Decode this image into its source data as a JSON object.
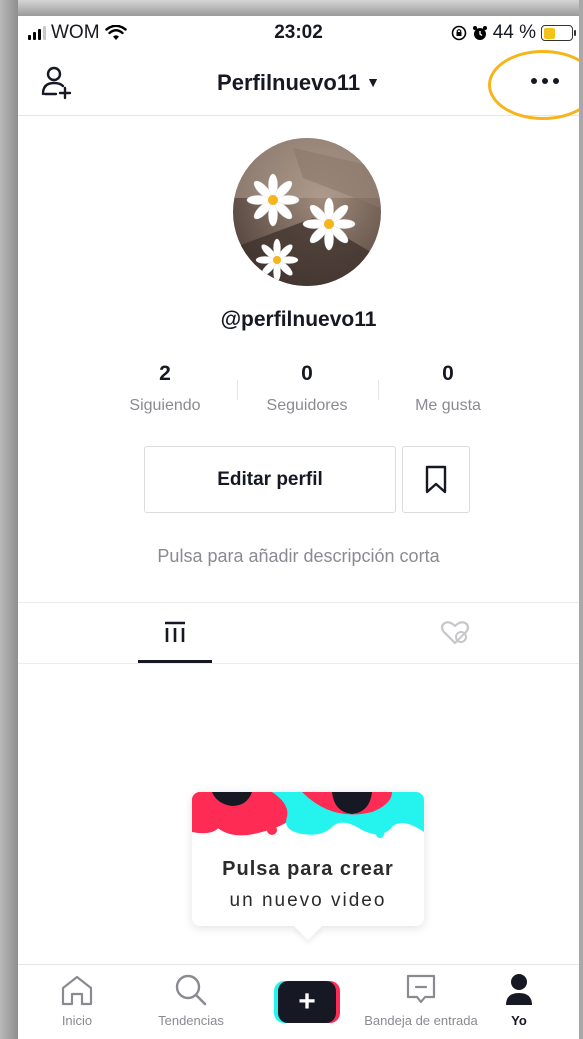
{
  "status_bar": {
    "carrier": "WOM",
    "time": "23:02",
    "battery_text": "44 %",
    "battery_level": 0.44,
    "battery_color": "#f3c318"
  },
  "header": {
    "title": "Perfilnuevo11",
    "caret": "▼",
    "left_icon": "add-user-icon",
    "right_icon": "more-options-icon",
    "highlight_color": "#f5b51b"
  },
  "profile": {
    "username": "@perfilnuevo11",
    "stats": [
      {
        "value": "2",
        "label": "Siguiendo"
      },
      {
        "value": "0",
        "label": "Seguidores"
      },
      {
        "value": "0",
        "label": "Me gusta"
      }
    ],
    "edit_button": "Editar perfil",
    "bookmark_icon": "bookmark-icon",
    "bio_placeholder": "Pulsa para añadir descripción corta"
  },
  "tabs": [
    {
      "icon": "videos-grid-icon",
      "active": true
    },
    {
      "icon": "liked-videos-icon",
      "active": false
    }
  ],
  "create_prompt": {
    "line1": "Pulsa para crear",
    "line2": "un nuevo video"
  },
  "bottom_nav": [
    {
      "label": "Inicio",
      "icon": "home-icon",
      "active": false
    },
    {
      "label": "Tendencias",
      "icon": "search-icon",
      "active": false
    },
    {
      "label": "",
      "icon": "plus-icon",
      "active": false
    },
    {
      "label": "Bandeja de entrada",
      "icon": "inbox-icon",
      "active": false
    },
    {
      "label": "Yo",
      "icon": "profile-icon",
      "active": true
    }
  ],
  "colors": {
    "primary_text": "#161823",
    "secondary_text": "#8a8b91",
    "brand_cyan": "#25f4ee",
    "brand_red": "#fe2c55"
  }
}
